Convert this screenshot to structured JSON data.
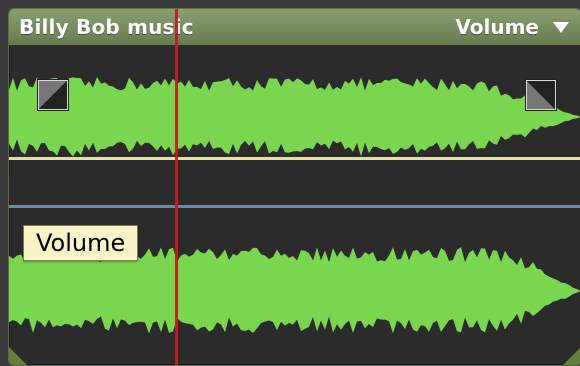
{
  "header": {
    "title": "Billy Bob music",
    "dropdown_label": "Volume",
    "dropdown_icon": "triangle-down-icon"
  },
  "tooltip": {
    "label": "Volume"
  },
  "colors": {
    "waveform": "#7bd64f",
    "playhead": "#c61b1b",
    "yellow_line": "#e5e0a8",
    "blue_line": "#6b8aa4"
  },
  "icons": {
    "fade_in": "fade-in-icon",
    "fade_out": "fade-out-icon"
  }
}
